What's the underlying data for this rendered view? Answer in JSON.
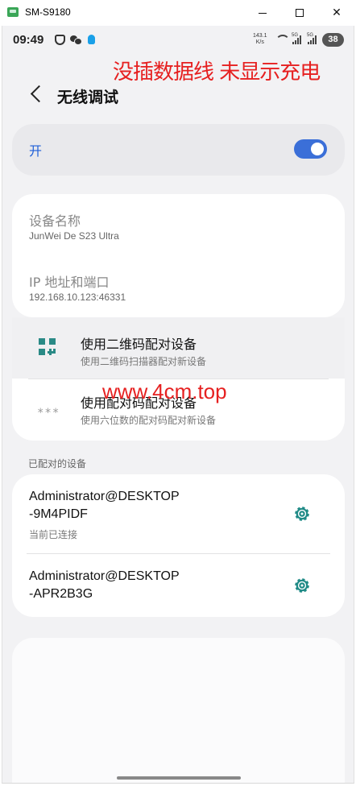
{
  "window": {
    "title": "SM-S9180"
  },
  "status_bar": {
    "time": "09:49",
    "speed_value": "143.1",
    "speed_unit": "K/s",
    "net1": "5G",
    "net2": "5G",
    "battery": "38"
  },
  "overlay": {
    "top_text": "没插数据线 未显示充电",
    "mid_text": "www.4cm.top",
    "color": "#e62020"
  },
  "header": {
    "title": "无线调试"
  },
  "toggle": {
    "label": "开",
    "state": "on",
    "accent": "#3b6fd8"
  },
  "info": {
    "device_name_label": "设备名称",
    "device_name_value": "JunWei De S23 Ultra",
    "ip_label": "IP 地址和端口",
    "ip_value": "192.168.10.123:46331"
  },
  "pairing": {
    "qr": {
      "title": "使用二维码配对设备",
      "subtitle": "使用二维码扫描器配对新设备"
    },
    "code": {
      "dots": "***",
      "title": "使用配对码配对设备",
      "subtitle": "使用六位数的配对码配对新设备"
    }
  },
  "paired": {
    "section_label": "已配对的设备",
    "devices": [
      {
        "name_line1": "Administrator@DESKTOP",
        "name_line2": "-9M4PIDF",
        "status": "当前已连接"
      },
      {
        "name_line1": "Administrator@DESKTOP",
        "name_line2": "-APR2B3G",
        "status": ""
      }
    ],
    "icon_color": "#1f8a86"
  }
}
